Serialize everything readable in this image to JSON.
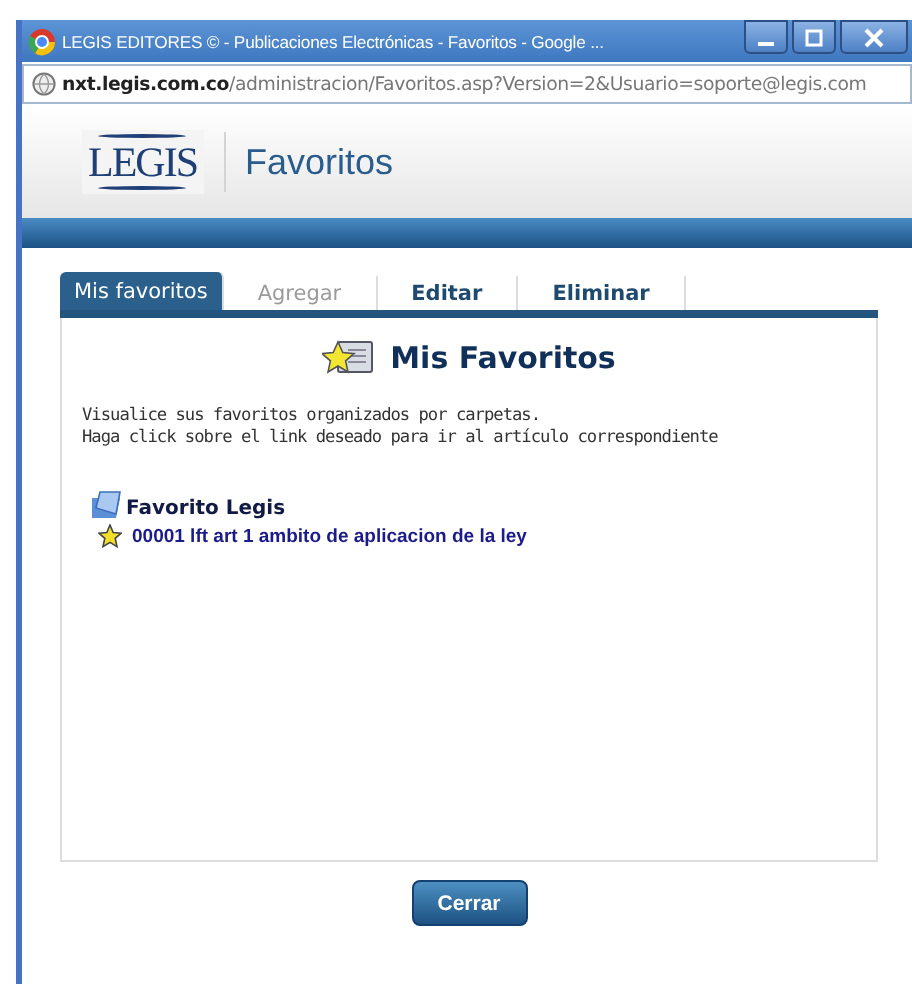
{
  "window": {
    "title": "LEGIS EDITORES © - Publicaciones Electrónicas - Favoritos - Google ..."
  },
  "address_bar": {
    "host": "nxt.legis.com.co",
    "path": "/administracion/Favoritos.asp?Version=2&Usuario=soporte@legis.com"
  },
  "header": {
    "logo": "LEGIS",
    "title": "Favoritos"
  },
  "tabs": [
    {
      "label": "Mis favoritos",
      "selected": true,
      "disabled": false
    },
    {
      "label": "Agregar",
      "selected": false,
      "disabled": true
    },
    {
      "label": "Editar",
      "selected": false,
      "disabled": false
    },
    {
      "label": "Eliminar",
      "selected": false,
      "disabled": false
    }
  ],
  "panel": {
    "heading": "Mis Favoritos",
    "description": [
      "Visualice sus favoritos organizados por carpetas.",
      "Haga click sobre el link deseado para ir al artículo correspondiente"
    ],
    "folders": [
      {
        "name": "Favorito Legis",
        "items": [
          {
            "label": "00001 lft art 1 ambito de aplicacion de la ley"
          }
        ]
      }
    ]
  },
  "buttons": [
    "Cerrar"
  ]
}
